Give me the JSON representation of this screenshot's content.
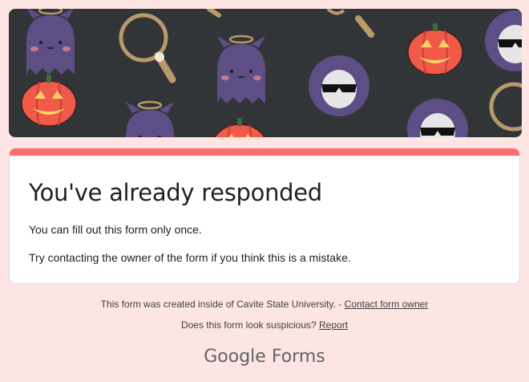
{
  "header": {
    "banner_description": "halloween-pattern",
    "accent_color": "#ff6f69"
  },
  "card": {
    "title": "You've already responded",
    "line1": "You can fill out this form only once.",
    "line2": "Try contacting the owner of the form if you think this is a mistake."
  },
  "footer": {
    "created_text": "This form was created inside of Cavite State University. - ",
    "contact_link": "Contact form owner",
    "suspicious_text": "Does this form look suspicious? ",
    "report_link": "Report",
    "brand_google": "Google",
    "brand_forms": "Forms"
  },
  "colors": {
    "background": "#fde5e4",
    "banner_bg": "#323537",
    "ghost": "#5e4e86",
    "pumpkin": "#f05a48",
    "ring": "#b8996a"
  }
}
